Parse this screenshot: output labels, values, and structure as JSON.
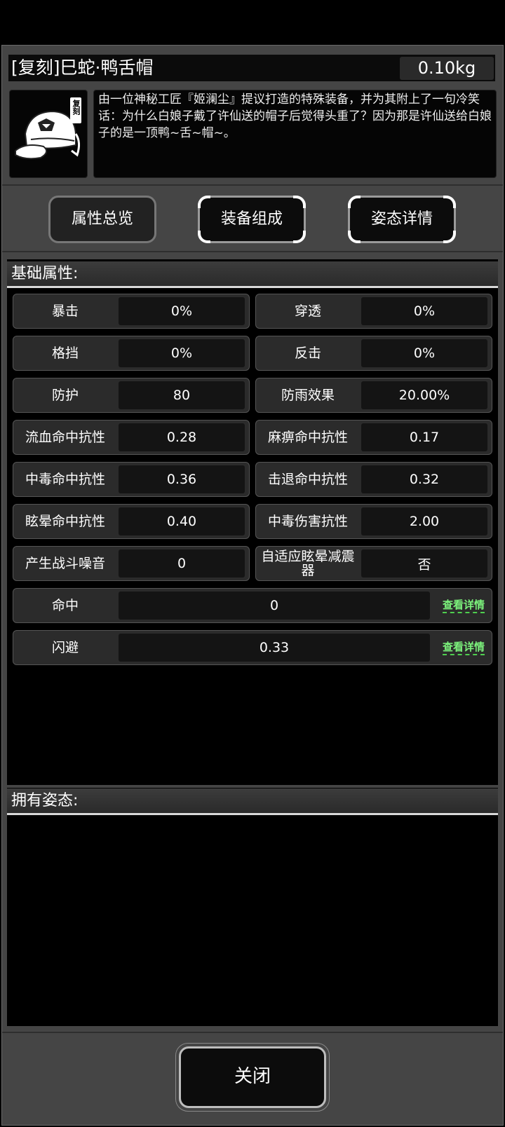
{
  "item": {
    "title": "[复刻]巳蛇·鸭舌帽",
    "weight": "0.10kg",
    "badge": "复刻",
    "description": "由一位神秘工匠『姬澜尘』提议打造的特殊装备，并为其附上了一句冷笑话：为什么白娘子戴了许仙送的帽子后觉得头重了？因为那是许仙送给白娘子的是一顶鸭~舌~帽~。",
    "icon": "cap-icon"
  },
  "tabs": [
    {
      "label": "属性总览",
      "active": true
    },
    {
      "label": "装备组成",
      "active": false
    },
    {
      "label": "姿态详情",
      "active": false
    }
  ],
  "basic": {
    "header": "基础属性:",
    "pairs": [
      {
        "l1": "暴击",
        "v1": "0%",
        "l2": "穿透",
        "v2": "0%"
      },
      {
        "l1": "格挡",
        "v1": "0%",
        "l2": "反击",
        "v2": "0%"
      },
      {
        "l1": "防护",
        "v1": "80",
        "l2": "防雨效果",
        "v2": "20.00%"
      },
      {
        "l1": "流血命中抗性",
        "v1": "0.28",
        "l2": "麻痹命中抗性",
        "v2": "0.17"
      },
      {
        "l1": "中毒命中抗性",
        "v1": "0.36",
        "l2": "击退命中抗性",
        "v2": "0.32"
      },
      {
        "l1": "眩晕命中抗性",
        "v1": "0.40",
        "l2": "中毒伤害抗性",
        "v2": "2.00"
      },
      {
        "l1": "产生战斗噪音",
        "v1": "0",
        "l2": "自适应眩晕减震器",
        "v2": "否"
      }
    ],
    "wide": [
      {
        "label": "命中",
        "value": "0",
        "link": "查看详情"
      },
      {
        "label": "闪避",
        "value": "0.33",
        "link": "查看详情"
      }
    ]
  },
  "stance": {
    "header": "拥有姿态:"
  },
  "close_label": "关闭",
  "colors": {
    "link_green": "#7cf27c",
    "panel": "#454545",
    "cell": "#2b2b2b"
  }
}
